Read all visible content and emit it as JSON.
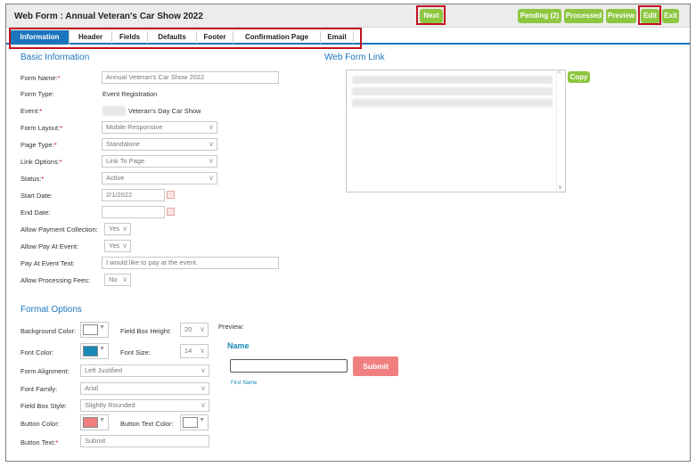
{
  "header": {
    "title": "Web Form : Annual Veteran's Car Show 2022",
    "buttons": {
      "next": "Next",
      "pending": "Pending (2)",
      "processed": "Processed",
      "preview": "Preview",
      "edit": "Edit",
      "exit": "Exit"
    }
  },
  "tabs": [
    "Information",
    "Header",
    "Fields",
    "Defaults",
    "Footer",
    "Confirmation Page",
    "Email"
  ],
  "basic": {
    "title": "Basic Information",
    "form_name_label": "Form Name:",
    "form_name_value": "Annual Veteran's Car Show 2022",
    "form_type_label": "Form Type:",
    "form_type_value": "Event Registration",
    "event_label": "Event:",
    "event_value": "Veteran's Day Car Show",
    "form_layout_label": "Form Layout:",
    "form_layout_value": "Mobile Responsive",
    "page_type_label": "Page Type:",
    "page_type_value": "Standalone",
    "link_options_label": "Link Options:",
    "link_options_value": "Link To Page",
    "status_label": "Status:",
    "status_value": "Active",
    "start_date_label": "Start Date:",
    "start_date_value": "2/1/2022",
    "end_date_label": "End Date:",
    "end_date_value": "",
    "allow_payment_label": "Allow Payment Collection:",
    "allow_payment_value": "Yes",
    "allow_pay_event_label": "Allow Pay At Event:",
    "allow_pay_event_value": "Yes",
    "pay_event_text_label": "Pay At Event Text:",
    "pay_event_text_value": "I would like to pay at the event.",
    "allow_fees_label": "Allow Processing Fees:",
    "allow_fees_value": "No",
    "required_mark": "*"
  },
  "web_form_link": {
    "title": "Web Form Link",
    "copy_label": "Copy"
  },
  "format": {
    "title": "Format Options",
    "bg_color_label": "Background Color:",
    "font_color_label": "Font Color:",
    "field_box_height_label": "Field Box Height:",
    "field_box_height_value": "20",
    "font_size_label": "Font Size:",
    "font_size_value": "14",
    "form_alignment_label": "Form Alignment:",
    "form_alignment_value": "Left Justified",
    "font_family_label": "Font Family:",
    "font_family_value": "Arial",
    "field_box_style_label": "Field Box Style:",
    "field_box_style_value": "Slightly Rounded",
    "button_color_label": "Button Color:",
    "button_text_color_label": "Button Text Color:",
    "button_text_label": "Button Text:",
    "button_text_value": "Submit",
    "colors": {
      "background": "#ffffff",
      "font": "#1b8ab8",
      "button": "#f08080",
      "button_text": "#ffffff"
    }
  },
  "preview": {
    "label": "Preview:",
    "name_heading": "Name",
    "first_name_caption": "First Name",
    "submit_label": "Submit"
  },
  "colors": {
    "accent_green": "#8dc63f",
    "accent_blue": "#1b75bc",
    "highlight_red": "#c1121f"
  }
}
